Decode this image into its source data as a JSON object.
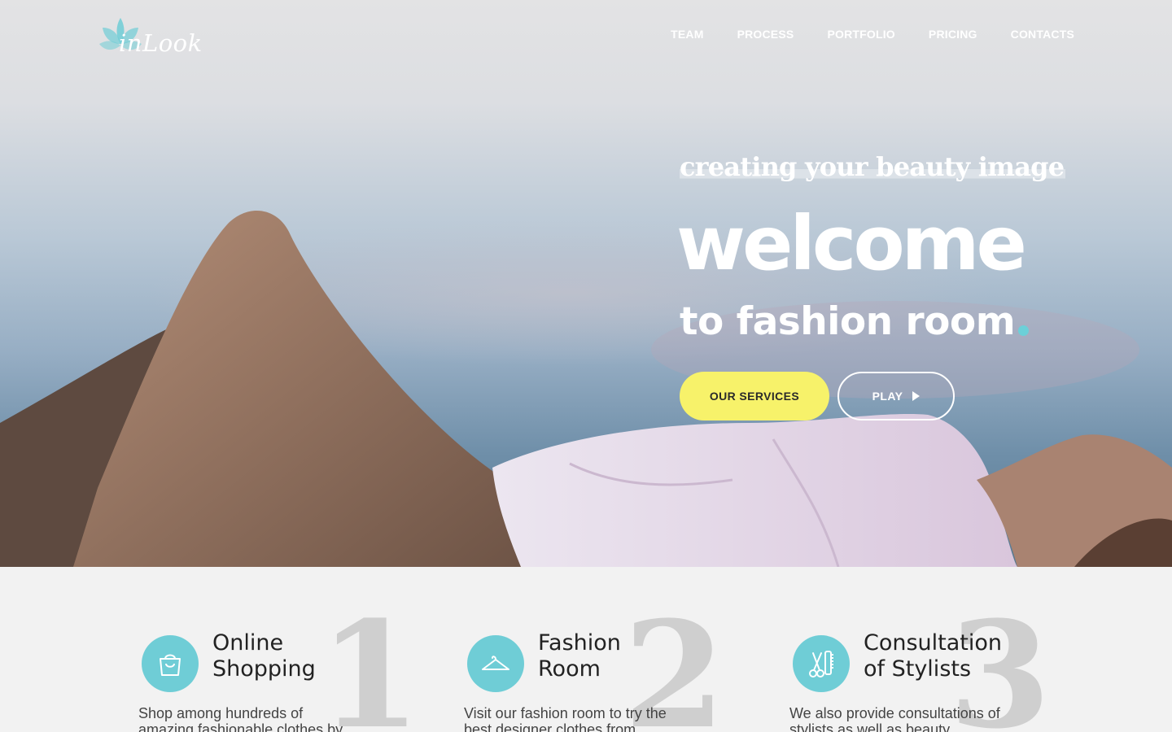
{
  "brand": {
    "name": "inLook",
    "accent_color": "#6cd0d8",
    "button_color": "#f7f26a"
  },
  "nav": {
    "items": [
      {
        "label": "TEAM"
      },
      {
        "label": "PROCESS"
      },
      {
        "label": "PORTFOLIO"
      },
      {
        "label": "PRICING"
      },
      {
        "label": "CONTACTS"
      }
    ]
  },
  "hero": {
    "tagline": "creating your beauty image",
    "headline": "welcome",
    "subheadline": "to fashion room",
    "primary_button": "OUR SERVICES",
    "secondary_button": "PLAY"
  },
  "features": [
    {
      "icon": "shopping-bag-icon",
      "number": "1",
      "title_line1": "Online",
      "title_line2": "Shopping",
      "description": "Shop among hundreds of amazing fashionable clothes by"
    },
    {
      "icon": "hanger-icon",
      "number": "2",
      "title_line1": "Fashion",
      "title_line2": "Room",
      "description": "Visit our fashion room to try the best designer clothes from"
    },
    {
      "icon": "scissors-comb-icon",
      "number": "3",
      "title_line1": "Consultation",
      "title_line2": "of Stylists",
      "description": "We also provide consultations of stylists as well as beauty"
    }
  ]
}
